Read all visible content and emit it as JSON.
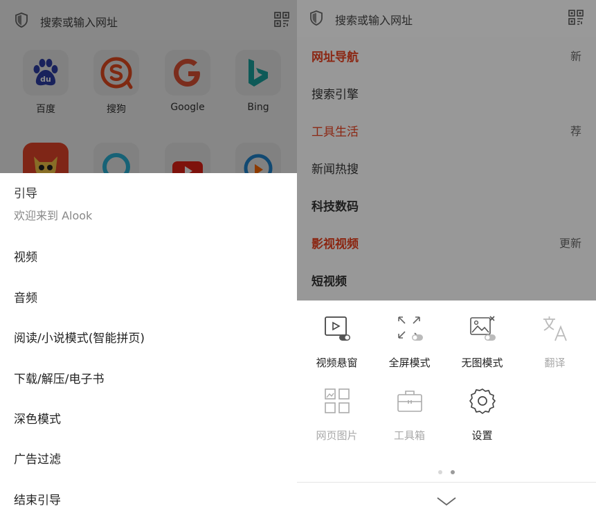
{
  "left": {
    "search_placeholder": "搜索或输入网址",
    "grid": [
      {
        "label": "百度",
        "icon": "baidu-logo"
      },
      {
        "label": "搜狗",
        "icon": "sogou-logo"
      },
      {
        "label": "Google",
        "icon": "google-logo"
      },
      {
        "label": "Bing",
        "icon": "bing-logo"
      }
    ],
    "grid_row2_icons": [
      "red-app-logo",
      "ring-app-logo",
      "youtube-logo",
      "play-circle-logo"
    ],
    "guide": {
      "title": "引导",
      "subtitle": "欢迎来到 Alook",
      "items": [
        "视频",
        "音频",
        "阅读/小说模式(智能拼页)",
        "下载/解压/电子书",
        "深色模式",
        "广告过滤",
        "结束引导"
      ]
    }
  },
  "right": {
    "search_placeholder": "搜索或输入网址",
    "nav": [
      {
        "label": "网址导航",
        "badge": "新",
        "highlight": true
      },
      {
        "label": "搜索引擎",
        "badge": "",
        "highlight": false
      },
      {
        "label": "工具生活",
        "badge": "荐",
        "highlight": true
      },
      {
        "label": "新闻热搜",
        "badge": "",
        "highlight": false
      },
      {
        "label": "科技数码",
        "badge": "",
        "highlight": false
      },
      {
        "label": "影视视频",
        "badge": "更新",
        "highlight": true
      },
      {
        "label": "短视频",
        "badge": "",
        "highlight": false
      }
    ],
    "tools": [
      {
        "label": "视频悬窗",
        "icon": "video-float-icon",
        "enabled": true
      },
      {
        "label": "全屏模式",
        "icon": "fullscreen-icon",
        "enabled": true
      },
      {
        "label": "无图模式",
        "icon": "no-image-icon",
        "enabled": true
      },
      {
        "label": "翻译",
        "icon": "translate-icon",
        "enabled": false
      },
      {
        "label": "网页图片",
        "icon": "web-images-icon",
        "enabled": false
      },
      {
        "label": "工具箱",
        "icon": "toolbox-icon",
        "enabled": false
      },
      {
        "label": "设置",
        "icon": "gear-icon",
        "enabled": true
      }
    ],
    "page_indicator": {
      "count": 2,
      "active": 1
    }
  },
  "colors": {
    "accent": "#e1401f",
    "muted": "#a8a8a8"
  }
}
